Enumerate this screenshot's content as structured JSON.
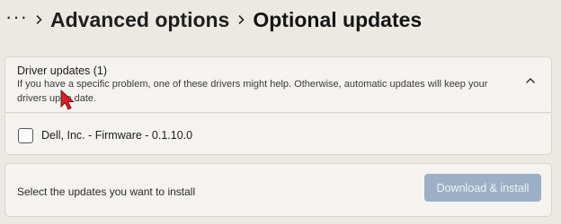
{
  "breadcrumb": {
    "more_label": "···",
    "items": [
      {
        "label": "Advanced options"
      },
      {
        "label": "Optional updates"
      }
    ]
  },
  "driver_updates": {
    "title": "Driver updates (1)",
    "description": "If you have a specific problem, one of these drivers might help. Otherwise, automatic updates will keep your drivers up to date.",
    "expanded": true,
    "items": [
      {
        "label": "Dell, Inc. - Firmware - 0.1.10.0",
        "checked": false
      }
    ]
  },
  "footer": {
    "prompt": "Select the updates you want to install",
    "download_button_label": "Download & install",
    "download_button_enabled": false
  },
  "colors": {
    "background": "#ece9e3",
    "card": "#f5f3ef",
    "button_disabled": "#9bb0c6",
    "cursor": "#d8202a"
  },
  "icons": {
    "more": "more-horizontal-icon",
    "separator": "chevron-right-icon",
    "expand": "chevron-up-icon",
    "pointer": "mouse-cursor-icon"
  }
}
